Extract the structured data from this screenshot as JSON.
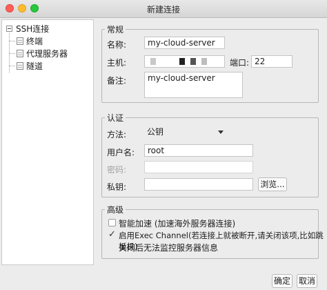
{
  "window": {
    "title": "新建连接"
  },
  "tree": {
    "root": "SSH连接",
    "items": [
      "终端",
      "代理服务器",
      "隧道"
    ]
  },
  "general": {
    "legend": "常规",
    "name_label": "名称:",
    "name_value": "my-cloud-server",
    "host_label": "主机:",
    "port_label": "端口:",
    "port_value": "22",
    "note_label": "备注:",
    "note_value": "my-cloud-server"
  },
  "auth": {
    "legend": "认证",
    "method_label": "方法:",
    "method_value": "公钥",
    "user_label": "用户名:",
    "user_value": "root",
    "password_label": "密码:",
    "key_label": "私钥:",
    "browse_label": "浏览..."
  },
  "advanced": {
    "legend": "高级",
    "smart_accel_label": "智能加速 (加速海外服务器连接)",
    "smart_accel_checked": false,
    "exec_channel_label": "启用Exec Channel(若连接上就被断开,请关闭该项,比如跳板机)",
    "exec_channel_checked": true,
    "exec_channel_note": "关闭后无法监控服务器信息"
  },
  "footer": {
    "ok_label": "确定",
    "cancel_label": "取消"
  }
}
